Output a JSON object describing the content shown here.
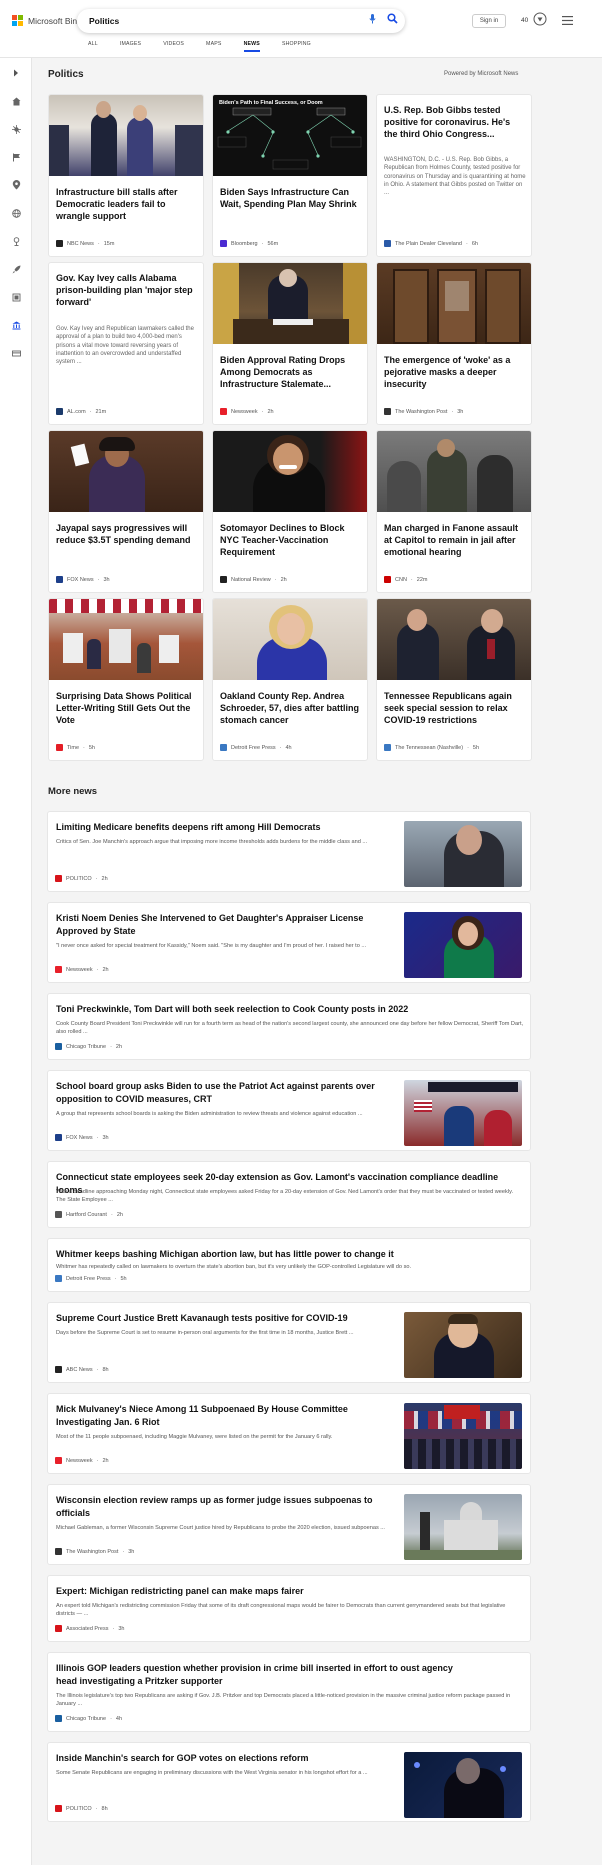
{
  "header": {
    "brand": "Microsoft Bing",
    "search_value": "Politics",
    "signin_label": "Sign in",
    "reward_count": "40",
    "tabs": [
      "ALL",
      "IMAGES",
      "VIDEOS",
      "MAPS",
      "NEWS",
      "SHOPPING"
    ],
    "active_tab": "NEWS"
  },
  "section": {
    "title": "Politics",
    "powered_by": "Powered by Microsoft News",
    "more_title": "More news"
  },
  "colors": {
    "accent": "#174ae4"
  },
  "cards": [
    {
      "title": "Infrastructure bill stalls after Democratic leaders fail to wrangle support",
      "snippet": "",
      "source": "NBC News",
      "time": "15m",
      "logo": "#222"
    },
    {
      "title": "Biden Says Infrastructure Can Wait, Spending Plan May Shrink",
      "snippet": "",
      "source": "Bloomberg",
      "time": "56m",
      "logo": "#4b2bd1"
    },
    {
      "title": "U.S. Rep. Bob Gibbs tested positive for coronavirus. He's the third Ohio Congress...",
      "snippet": "WASHINGTON, D.C. - U.S. Rep. Bob Gibbs, a Republican from Holmes County, tested positive for coronavirus on Thursday and is quarantining at home in Ohio. A statement that Gibbs posted on Twitter on ...",
      "source": "The Plain Dealer Cleveland",
      "time": "6h",
      "logo": "#2a5aa8"
    },
    {
      "title": "Gov. Kay Ivey calls Alabama prison-building plan 'major step forward'",
      "snippet": "Gov. Kay Ivey and Republican lawmakers called the approval of a plan to build two 4,000-bed men's prisons a vital move toward reversing years of inattention to an overcrowded and understaffed system ...",
      "source": "AL.com",
      "time": "21m",
      "logo": "#1b3a6b"
    },
    {
      "title": "Biden Approval Rating Drops Among Democrats as Infrastructure Stalemate...",
      "snippet": "",
      "source": "Newsweek",
      "time": "2h",
      "logo": "#e8202a"
    },
    {
      "title": "The emergence of 'woke' as a pejorative masks a deeper insecurity",
      "snippet": "",
      "source": "The Washington Post",
      "time": "3h",
      "logo": "#333"
    },
    {
      "title": "Jayapal says progressives will reduce $3.5T spending demand",
      "snippet": "",
      "source": "FOX News",
      "time": "3h",
      "logo": "#1d3f8a"
    },
    {
      "title": "Sotomayor Declines to Block NYC Teacher-Vaccination Requirement",
      "snippet": "",
      "source": "National Review",
      "time": "2h",
      "logo": "#222"
    },
    {
      "title": "Man charged in Fanone assault at Capitol to remain in jail after emotional hearing",
      "snippet": "",
      "source": "CNN",
      "time": "22m",
      "logo": "#cc0000"
    },
    {
      "title": "Surprising Data Shows Political Letter-Writing Still Gets Out the Vote",
      "snippet": "",
      "source": "Time",
      "time": "5h",
      "logo": "#e41e26"
    },
    {
      "title": "Oakland County Rep. Andrea Schroeder, 57, dies after battling stomach cancer",
      "snippet": "",
      "source": "Detroit Free Press",
      "time": "4h",
      "logo": "#3a78c2"
    },
    {
      "title": "Tennessee Republicans again seek special session to relax COVID-19 restrictions",
      "snippet": "",
      "source": "The Tennessean (Nashville)",
      "time": "5h",
      "logo": "#3a78c2"
    }
  ],
  "more": [
    {
      "title": "Limiting Medicare benefits deepens rift among Hill Democrats",
      "snippet": "Critics of Sen. Joe Manchin's approach argue that imposing more income thresholds adds burdens for the middle class and ...",
      "source": "POLITICO",
      "time": "2h",
      "logo": "#d7141a"
    },
    {
      "title": "Kristi Noem Denies She Intervened to Get Daughter's Appraiser License Approved by State",
      "snippet": "\"I never once asked for special treatment for Kassidy,\" Noem said. \"She is my daughter and I'm proud of her. I raised her to ...",
      "source": "Newsweek",
      "time": "2h",
      "logo": "#e8202a"
    },
    {
      "title": "Toni Preckwinkle, Tom Dart will both seek reelection to Cook County posts in 2022",
      "snippet": "Cook County Board President Toni Preckwinkle will run for a fourth term as head of the nation's second largest county, she announced one day before her fellow Democrat, Sheriff Tom Dart, also rolled ...",
      "source": "Chicago Tribune",
      "time": "2h",
      "logo": "#1a5fa0"
    },
    {
      "title": "School board group asks Biden to use the Patriot Act against parents over opposition to COVID measures, CRT",
      "snippet": "A group that represents school boards is asking the Biden administration to review threats and violence against education ...",
      "source": "FOX News",
      "time": "3h",
      "logo": "#1d3f8a"
    },
    {
      "title": "Connecticut state employees seek 20-day extension as Gov. Lamont's vaccination compliance deadline looms",
      "snippet": "With a deadline approaching Monday night, Connecticut state employees asked Friday for a 20-day extension of Gov. Ned Lamont's order that they must be vaccinated or tested weekly. The State Employee ...",
      "source": "Hartford Courant",
      "time": "2h",
      "logo": "#555"
    },
    {
      "title": "Whitmer keeps bashing Michigan abortion law, but has little power to change it",
      "snippet": "Whitmer has repeatedly called on lawmakers to overturn the state's abortion ban, but it's very unlikely the GOP-controlled Legislature will do so.",
      "source": "Detroit Free Press",
      "time": "5h",
      "logo": "#3a78c2"
    },
    {
      "title": "Supreme Court Justice Brett Kavanaugh tests positive for COVID-19",
      "snippet": "Days before the Supreme Court is set to resume in-person oral arguments for the first time in 18 months, Justice Brett ...",
      "source": "ABC News",
      "time": "8h",
      "logo": "#222"
    },
    {
      "title": "Mick Mulvaney's Niece Among 11 Subpoenaed By House Committee Investigating Jan. 6 Riot",
      "snippet": "Most of the 11 people subpoenaed, including Maggie Mulvaney, were listed on the permit for the January 6 rally.",
      "source": "Newsweek",
      "time": "2h",
      "logo": "#e8202a"
    },
    {
      "title": "Wisconsin election review ramps up as former judge issues subpoenas to officials",
      "snippet": "Michael Gableman, a former Wisconsin Supreme Court justice hired by Republicans to probe the 2020 election, issued subpoenas ...",
      "source": "The Washington Post",
      "time": "3h",
      "logo": "#333"
    },
    {
      "title": "Expert: Michigan redistricting panel can make maps fairer",
      "snippet": "An expert told Michigan's redistricting commission Friday that some of its draft congressional maps would be fairer to Democrats than current gerrymandered seats but that legislative districts — ...",
      "source": "Associated Press",
      "time": "3h",
      "logo": "#d7141a"
    },
    {
      "title": "Illinois GOP leaders question whether provision in crime bill inserted in effort to oust agency head investigating a Pritzker supporter",
      "snippet": "The Illinois legislature's top two Republicans are asking if Gov. J.B. Pritzker and top Democrats placed a little-noticed provision in the massive criminal justice reform package passed in January ...",
      "source": "Chicago Tribune",
      "time": "4h",
      "logo": "#1a5fa0"
    },
    {
      "title": "Inside Manchin's search for GOP votes on elections reform",
      "snippet": "Some Senate Republicans are engaging in preliminary discussions with the West Virginia senator in his longshot effort for a ...",
      "source": "POLITICO",
      "time": "8h",
      "logo": "#d7141a"
    }
  ]
}
